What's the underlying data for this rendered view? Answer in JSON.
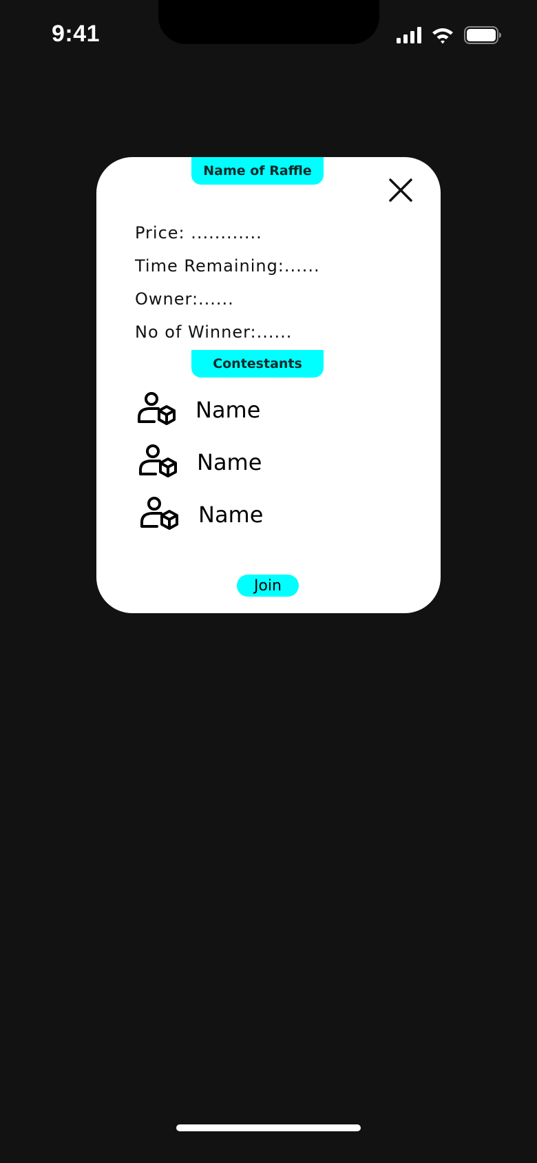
{
  "status_bar": {
    "time": "9:41"
  },
  "modal": {
    "title": "Name of Raffle",
    "price": "Price: ............",
    "time_remaining": "Time Remaining:......",
    "owner": "Owner:......",
    "winners": "No of Winner:......",
    "contestants_header": "Contestants",
    "contestants": [
      {
        "name": "Name"
      },
      {
        "name": "Name"
      },
      {
        "name": "Name"
      }
    ],
    "join_label": "Join"
  },
  "colors": {
    "background": "#121212",
    "accent": "#00ffff",
    "modal": "#ffffff"
  },
  "icons": {
    "close": "close-icon",
    "contestant": "user-box-icon",
    "signal": "cellular-signal-icon",
    "wifi": "wifi-icon",
    "battery": "battery-icon"
  }
}
